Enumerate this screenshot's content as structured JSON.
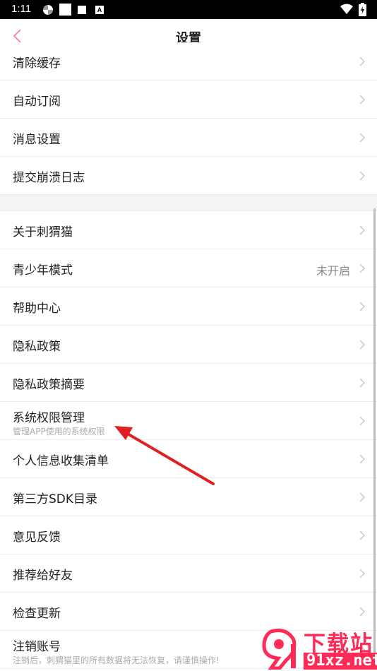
{
  "status_bar": {
    "time": "1:11",
    "icons": [
      "pinwheel-icon",
      "square-icon",
      "square-small-icon",
      "a-icon",
      "wifi-icon",
      "battery-icon"
    ],
    "a_icon_letter": "A"
  },
  "header": {
    "title": "设置",
    "back_icon": "chevron-left-icon",
    "accent_color": "#f48fb1"
  },
  "group1": [
    {
      "label": "清除缓存"
    },
    {
      "label": "自动订阅"
    },
    {
      "label": "消息设置"
    },
    {
      "label": "提交崩溃日志"
    }
  ],
  "group2": [
    {
      "label": "关于刺猬猫"
    },
    {
      "label": "青少年模式",
      "value": "未开启"
    },
    {
      "label": "帮助中心"
    },
    {
      "label": "隐私政策"
    },
    {
      "label": "隐私政策摘要"
    },
    {
      "label": "系统权限管理",
      "sub": "管理APP使用的系统权限"
    },
    {
      "label": "个人信息收集清单"
    },
    {
      "label": "第三方SDK目录"
    },
    {
      "label": "意见反馈"
    },
    {
      "label": "推荐给好友"
    },
    {
      "label": "检查更新"
    },
    {
      "label": "注销账号",
      "sub": "注销后，刺猬猫里的所有数据将无法恢复，请谨慎操作!"
    }
  ],
  "annotation": {
    "color": "#e02020"
  },
  "watermark": {
    "line1": "下载站",
    "line2": "91xz.net",
    "color": "#ff2a55"
  }
}
